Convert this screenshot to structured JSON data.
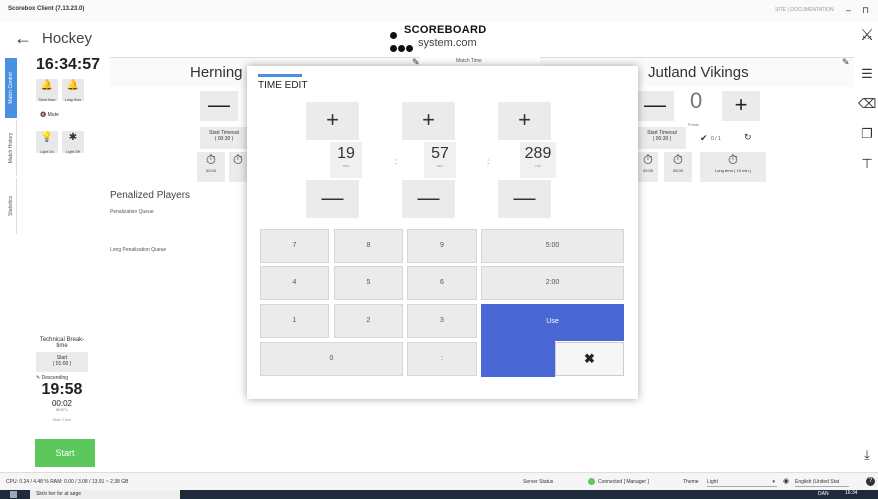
{
  "window": {
    "title": "Scorebox Client (7.13.23.0)",
    "user": "SITE | DOCUMENTATION",
    "minimize": "–",
    "pin": "⊓"
  },
  "header": {
    "back": "←",
    "sport": "Hockey",
    "logo_line1": "SCOREBOARD",
    "logo_line2": "system.com"
  },
  "left_tabs": [
    "Match Control",
    "Match History",
    "Statistics"
  ],
  "left_panel": {
    "clock": "16:34:57",
    "horn_short": "Short Horn",
    "horn_long": "Long Horn",
    "mute": "Mute",
    "light_on": "Light On",
    "light_off": "Light Off"
  },
  "home": {
    "name": "Herning Blue Fox (Kin)",
    "start_timeout": "Start Timeout",
    "timeout_val": "( 00:30 )",
    "clock_a": "02:00",
    "clock_b": "05:00"
  },
  "match_time_label": "Match Time",
  "away": {
    "name": "Jutland Vikings",
    "score": "0",
    "points_label": "Points",
    "start_timeout": "Start Timeout",
    "timeout_val": "( 00:30 )",
    "timeouts_used": "0 / 1",
    "clock_a": "02:00",
    "clock_b": "05:00",
    "long_term": "Long term ( 10 min )"
  },
  "penalized": {
    "title": "Penalized Players",
    "queue": "Penalization Queue",
    "long_queue": "Long Penalization Queue"
  },
  "break_block": {
    "title": "Technical Break-time",
    "start": "Start",
    "start_val": "( 01:00 )",
    "descending": "Descending",
    "time": "19:58",
    "sub": "00:02",
    "sub2": "89:57.1",
    "main_time": "Main Time",
    "start_btn": "Start"
  },
  "dialog": {
    "title": "TIME EDIT",
    "plus": "+",
    "minus": "—",
    "minutes": "19",
    "minutes_unit": "min",
    "seconds": "57",
    "seconds_unit": "sec",
    "millis": "289",
    "millis_unit": "ms",
    "sep": ":",
    "keys": {
      "k7": "7",
      "k8": "8",
      "k9": "9",
      "k4": "4",
      "k5": "5",
      "k6": "6",
      "k1": "1",
      "k2": "2",
      "k3": "3",
      "k0": "0",
      "colon": ":",
      "p500": "5:00",
      "p200": "2:00",
      "use": "Use",
      "close": "✖"
    }
  },
  "statusbar": {
    "sys": "CPU: 0.24 / 4.48 % RAM: 0.00 / 3.08 / 13.91 ~ 2.38 GB",
    "server_status": "Server Status",
    "connected": "Connected [ Manager ]",
    "theme_label": "Theme",
    "theme_val": "Light",
    "language": "English (United Stat",
    "help": "?"
  },
  "taskbar": {
    "search": "Skriv her for at søge",
    "time": "16:34",
    "lang": "DAN"
  },
  "colors": {
    "accent": "#4a90e2",
    "use": "#4a67d6",
    "start": "#5cc85c",
    "connected": "#5cc85c"
  }
}
